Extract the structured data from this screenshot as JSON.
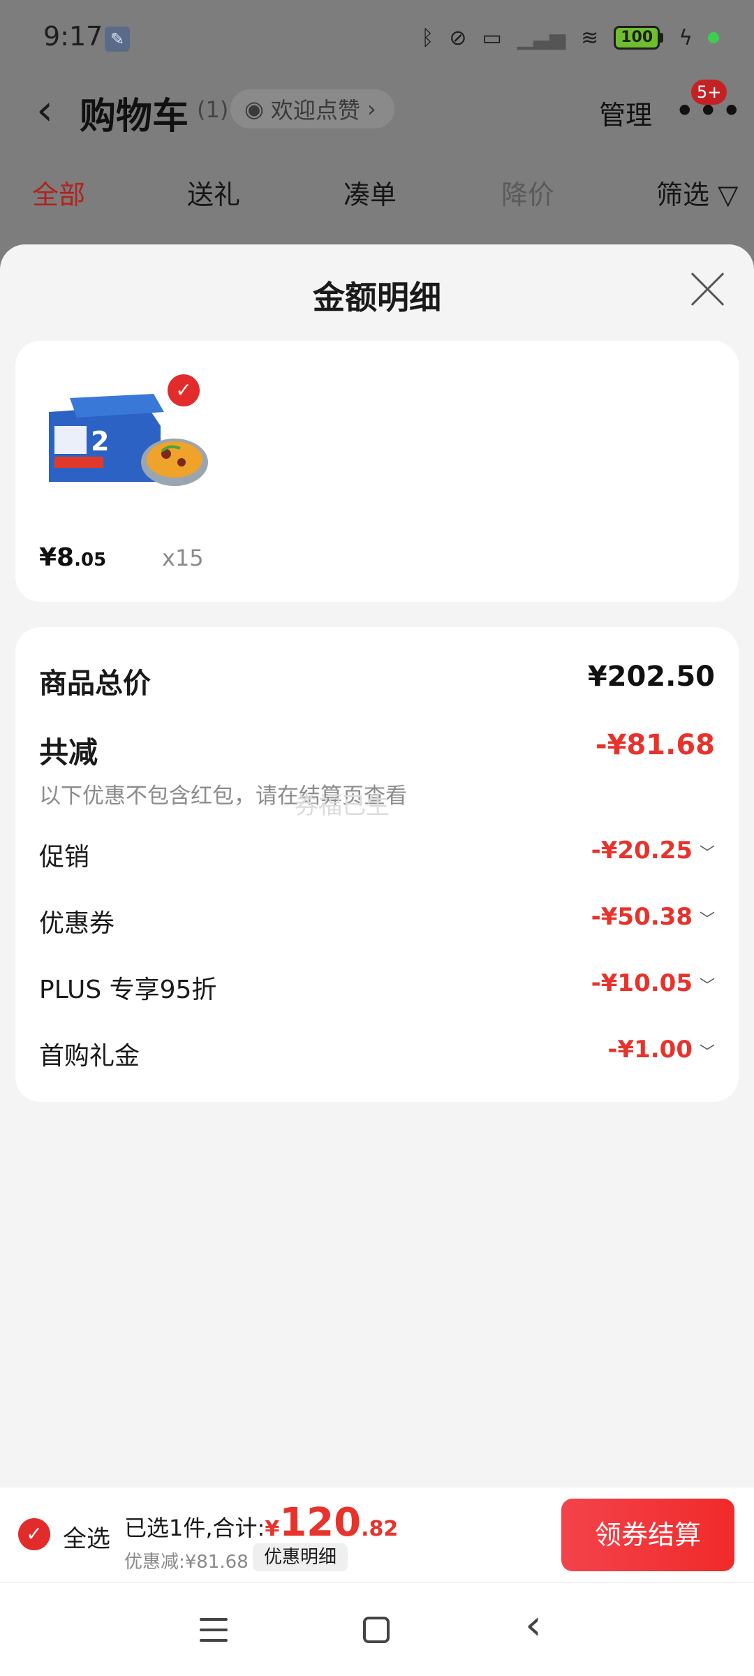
{
  "status_bar": {
    "time": "9:17",
    "battery": "100",
    "icons": [
      "wrench-icon",
      "bluetooth-icon",
      "vibrate-off-icon",
      "laptop-icon",
      "signal-icon",
      "wifi-icon",
      "battery-icon",
      "charging-icon"
    ]
  },
  "nav": {
    "title": "购物车",
    "count": "(1)",
    "praise": "欢迎点赞",
    "manage": "管理",
    "badge": "5+"
  },
  "tabs": [
    {
      "label": "全部",
      "active": true
    },
    {
      "label": "送礼"
    },
    {
      "label": "凑单"
    },
    {
      "label": "降价"
    },
    {
      "label": "筛选"
    }
  ],
  "sheet": {
    "title": "金额明细",
    "product": {
      "price_int": "¥8",
      "price_dec": ".05",
      "qty": "x15"
    },
    "total": {
      "label": "商品总价",
      "value": "¥202.50"
    },
    "reduce": {
      "label": "共减",
      "value": "-¥81.68",
      "note": "以下优惠不包含红包，请在结算页查看"
    },
    "watermark": "券福已生",
    "items": [
      {
        "label": "促销",
        "value": "-¥20.25"
      },
      {
        "label": "优惠券",
        "value": "-¥50.38"
      },
      {
        "label": "PLUS 专享95折",
        "value": "-¥10.05"
      },
      {
        "label": "首购礼金",
        "value": "-¥1.00"
      }
    ]
  },
  "bottom_bar": {
    "select_all": "全选",
    "sum_label": "已选1件,合计:",
    "sum_yen": "¥",
    "sum_int": "120",
    "sum_dec": ".82",
    "discount": "优惠减:¥81.68",
    "detail_button": "优惠明细",
    "checkout": "领券结算"
  },
  "colors": {
    "accent": "#e8322b",
    "checkout_gradient_start": "#f2434b",
    "checkout_gradient_end": "#f12a2a"
  }
}
